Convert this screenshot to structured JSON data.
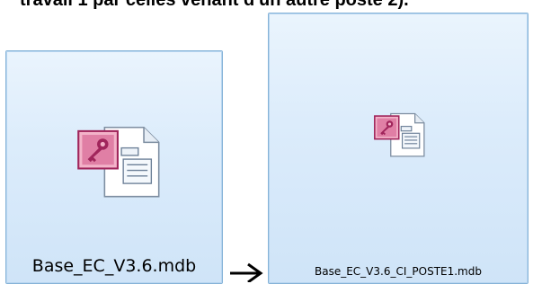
{
  "caption": "travail 1 par celles venant d'un autre poste 2).",
  "files": {
    "left": {
      "name": "Base_EC_V3.6.mdb",
      "icon": "access-database-icon"
    },
    "right": {
      "name": "Base_EC_V3.6_CI_POSTE1.mdb",
      "icon": "access-database-icon"
    }
  },
  "arrow": {
    "icon": "right-arrow-icon"
  },
  "colors": {
    "tile_border": "#86b3d8",
    "tile_bg": "#dcecfb",
    "access_magenta": "#a0255b",
    "access_pink": "#f3b3c9"
  }
}
